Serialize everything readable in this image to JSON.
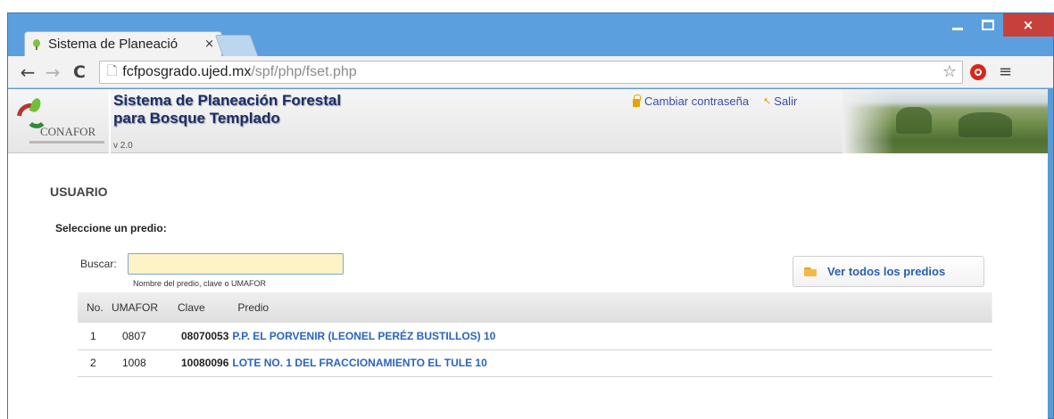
{
  "browser": {
    "tab_title": "Sistema de Planeació",
    "tab_close": "×",
    "url_host": "fcfposgrado.ujed.mx",
    "url_path": "/spf/php/fset.php",
    "close_glyph": "×"
  },
  "header": {
    "logo_text": "CONAFOR",
    "title_line1": "Sistema de Planeación Forestal",
    "title_line2": "para Bosque Templado",
    "version": "v 2.0",
    "change_password": "Cambiar contraseña",
    "logout": "Salir"
  },
  "content": {
    "section_title": "USUARIO",
    "select_label": "Seleccione un predio:",
    "search_label": "Buscar:",
    "search_value": "",
    "search_hint": "Nombre del predio, clave o UMAFOR",
    "view_all_button": "Ver todos los predios"
  },
  "table": {
    "headers": {
      "no": "No.",
      "umafor": "UMAFOR",
      "clave": "Clave",
      "predio": "Predio"
    },
    "rows": [
      {
        "no": "1",
        "umafor": "0807",
        "clave": "08070053",
        "predio": "P.P. EL PORVENIR (LEONEL PERÉZ BUSTILLOS) 10"
      },
      {
        "no": "2",
        "umafor": "1008",
        "clave": "10080096",
        "predio": "LOTE NO. 1 DEL FRACCIONAMIENTO EL TULE 10"
      }
    ]
  },
  "colors": {
    "window_frame": "#5c9fde",
    "close_button": "#c7413b",
    "link_blue": "#2a64c0",
    "title_navy": "#1b2e6b",
    "search_bg": "#fdf3c6"
  }
}
